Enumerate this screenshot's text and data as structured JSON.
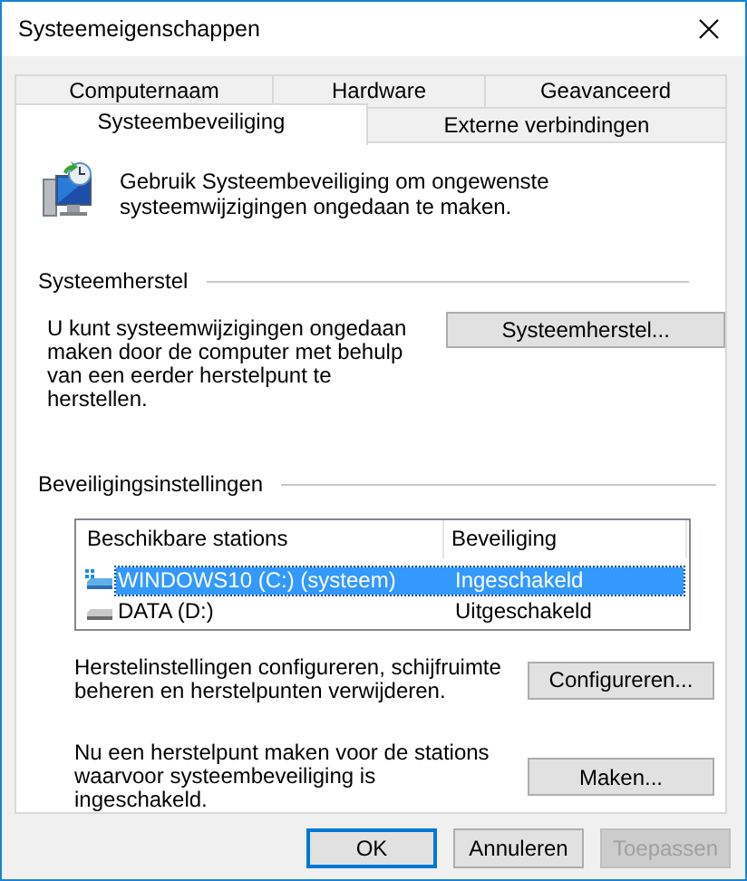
{
  "window": {
    "title": "Systeemeigenschappen"
  },
  "tab_rows": [
    [
      {
        "label": "Computernaam",
        "selected": false
      },
      {
        "label": "Hardware",
        "selected": false
      },
      {
        "label": "Geavanceerd",
        "selected": false
      }
    ],
    [
      {
        "label": "Systeembeveiliging",
        "selected": true
      },
      {
        "label": "Externe verbindingen",
        "selected": false
      }
    ]
  ],
  "intro": "Gebruik Systeembeveiliging om ongewenste systeemwijzigingen ongedaan te maken.",
  "system_restore": {
    "heading": "Systeemherstel",
    "text": "U kunt systeemwijzigingen ongedaan maken door de computer met behulp van een eerder herstelpunt te herstellen.",
    "button": "Systeemherstel..."
  },
  "protection_settings": {
    "heading": "Beveiligingsinstellingen",
    "table": {
      "columns": [
        "Beschikbare stations",
        "Beveiliging"
      ],
      "rows": [
        {
          "kind": "system",
          "name": "WINDOWS10 (C:) (systeem)",
          "protection": "Ingeschakeld",
          "selected": true
        },
        {
          "kind": "drive",
          "name": "DATA (D:)",
          "protection": "Uitgeschakeld",
          "selected": false
        }
      ]
    },
    "actions": [
      {
        "text": "Herstelinstellingen configureren, schijfruimte beheren en herstelpunten verwijderen.",
        "button": "Configureren..."
      },
      {
        "text": "Nu een herstelpunt maken voor de stations waarvoor systeembeveiliging is ingeschakeld.",
        "button": "Maken..."
      }
    ]
  },
  "buttons": [
    {
      "label": "OK",
      "default": true,
      "disabled": false
    },
    {
      "label": "Annuleren",
      "default": false,
      "disabled": false
    },
    {
      "label": "Toepassen",
      "default": false,
      "disabled": true
    }
  ]
}
